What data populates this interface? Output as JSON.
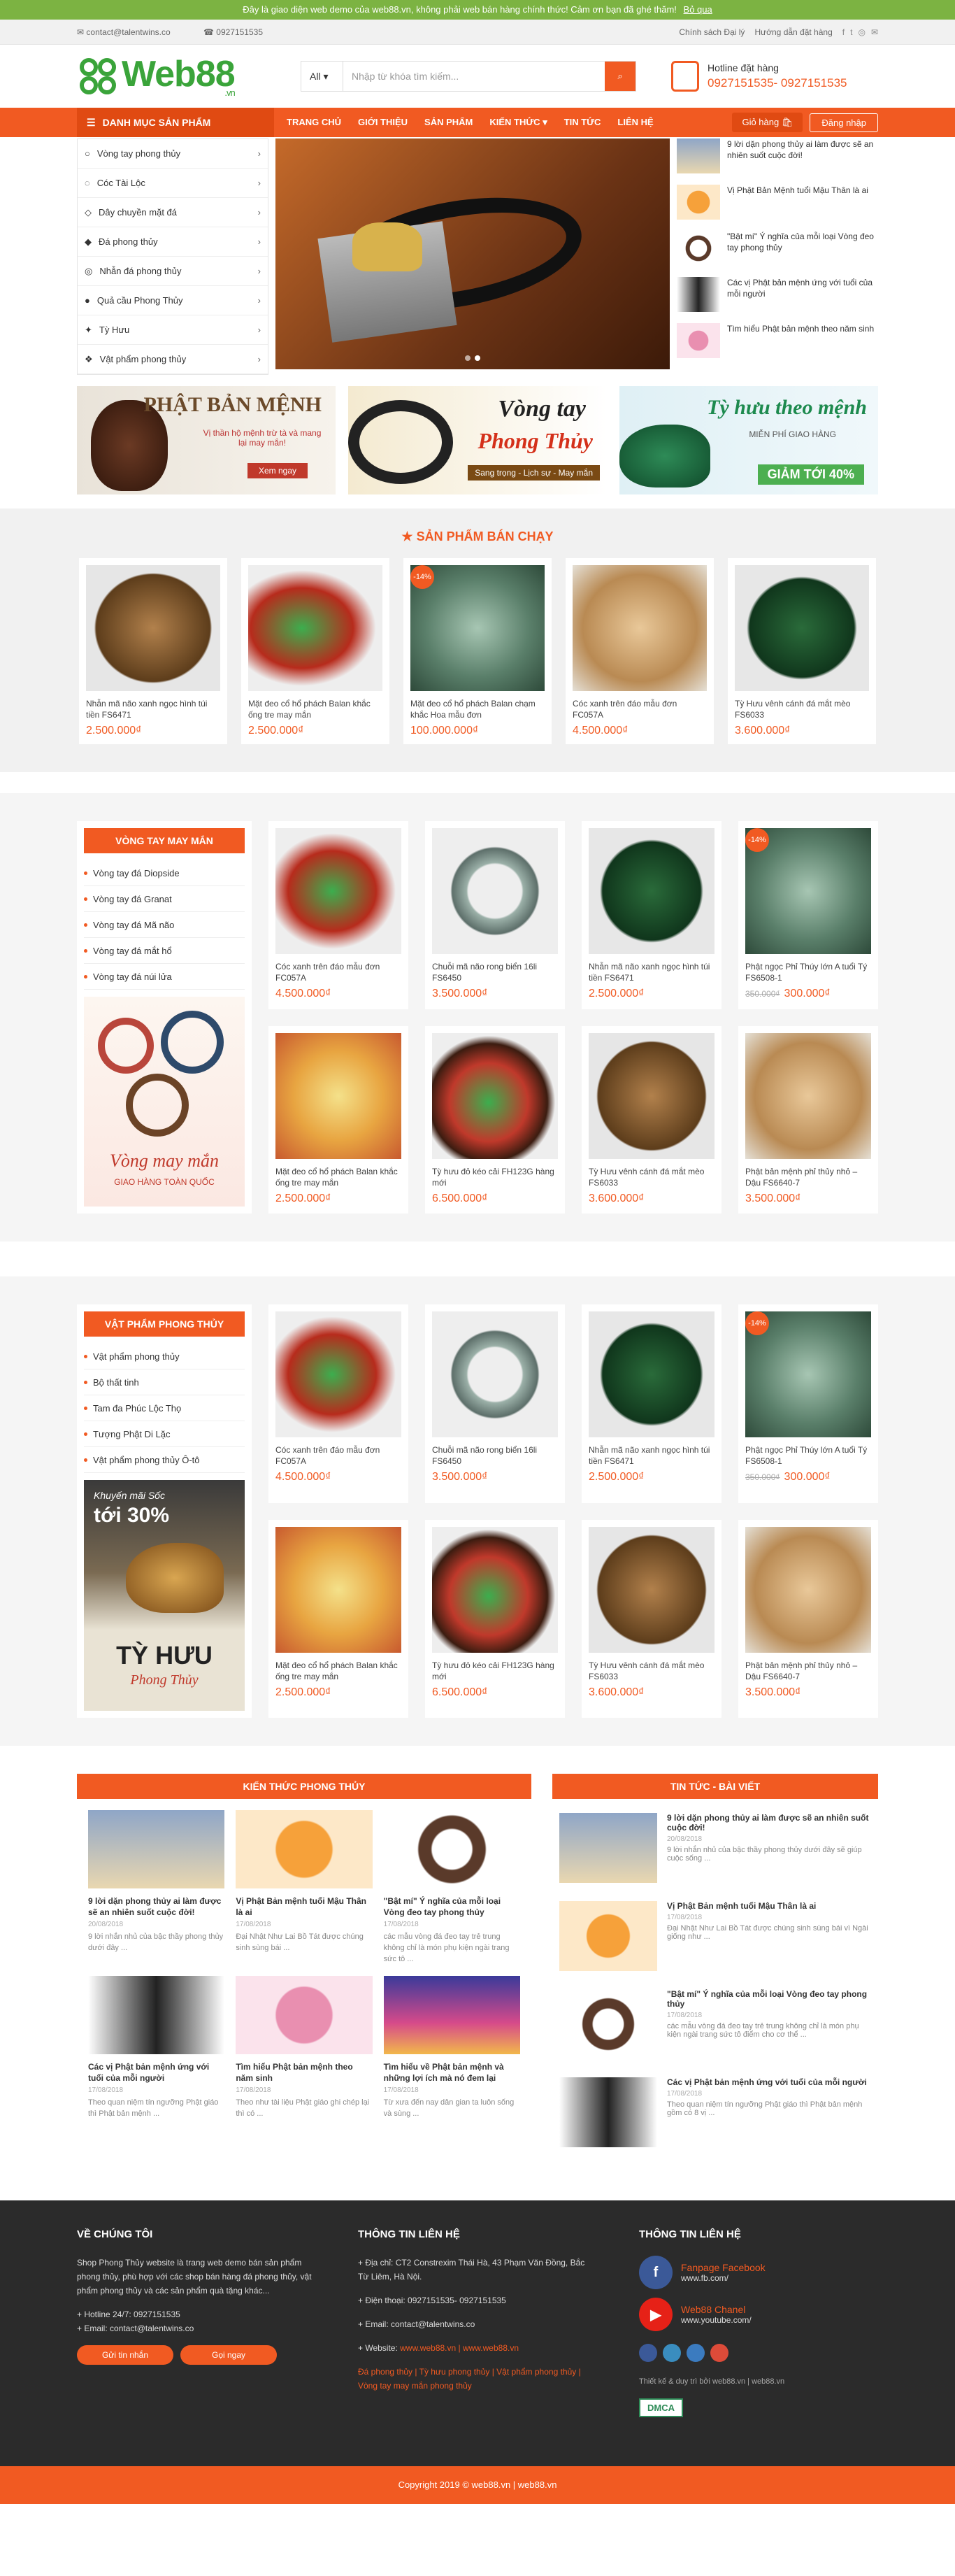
{
  "notice": {
    "text": "Đây là giao diện web demo của web88.vn, không phải web bán hàng chính thức! Cảm ơn bạn đã ghé thăm!",
    "dismiss": "Bỏ qua"
  },
  "topbar": {
    "email": "contact@talentwins.co",
    "phone": "0927151535",
    "policy": "Chính sách Đại lý",
    "guide": "Hướng dẫn đặt hàng"
  },
  "logo": {
    "text": "Web88",
    "sub": ".vn"
  },
  "search": {
    "category": "All",
    "placeholder": "Nhập từ khóa tìm kiếm..."
  },
  "hotline": {
    "label": "Hotline đặt hàng",
    "numbers": "0927151535- 0927151535"
  },
  "nav": {
    "category_label": "DANH MỤC SẢN PHẨM",
    "items": [
      "TRANG CHỦ",
      "GIỚI THIỆU",
      "SẢN PHẨM",
      "KIẾN THỨC",
      "TIN TỨC",
      "LIÊN HỆ"
    ],
    "cart": "Giỏ hàng",
    "login": "Đăng nhập"
  },
  "categories": [
    "Vòng tay phong thủy",
    "Cóc Tài Lộc",
    "Dây chuyền mặt đá",
    "Đá phong thủy",
    "Nhẫn đá phong thủy",
    "Quả cầu Phong Thủy",
    "Tỳ Hưu",
    "Vật phẩm phong thủy"
  ],
  "side_news": [
    "9 lời dặn phong thủy ai làm được sẽ an nhiên suốt cuộc đời!",
    "Vị Phật Bản Mệnh tuổi Mậu Thân là ai",
    "\"Bật mí\" Ý nghĩa của mỗi loại Vòng đeo tay phong thủy",
    "Các vị Phật bản mệnh ứng với tuổi của mỗi người",
    "Tìm hiểu Phật bản mệnh theo năm sinh"
  ],
  "banners": [
    {
      "title": "PHẬT BẢN MỆNH",
      "sub": "Vị thần hộ mệnh trừ tà và mang lại may mắn!",
      "btn": "Xem ngay"
    },
    {
      "title": "Vòng tay",
      "title2": "Phong Thủy",
      "sub": "Sang trọng - Lịch sự - May mắn"
    },
    {
      "title": "Tỳ hưu theo mệnh",
      "sub": "MIỄN PHÍ GIAO HÀNG",
      "promo": "GIẢM TỚI 40%"
    }
  ],
  "bestsellers": {
    "title": "SẢN PHẨM BÁN CHẠY",
    "items": [
      {
        "name": "Nhẫn mã não xanh ngọc hình túi tiền FS6471",
        "price": "2.500.000₫",
        "badge": ""
      },
      {
        "name": "Mặt đeo cổ hổ phách Balan khắc ống tre may mắn",
        "price": "2.500.000₫",
        "badge": ""
      },
      {
        "name": "Mặt đeo cổ hổ phách Balan chạm khắc Hoa mẫu đơn",
        "price": "100.000.000₫",
        "badge": "-14%"
      },
      {
        "name": "Cóc xanh trên đáo mẫu đơn FC057A",
        "price": "4.500.000₫",
        "badge": ""
      },
      {
        "name": "Tỳ Hưu vênh cánh đá mắt mèo FS6033",
        "price": "3.600.000₫",
        "badge": ""
      }
    ]
  },
  "block1": {
    "title": "VÒNG TAY MAY MẮN",
    "links": [
      "Vòng tay đá Diopside",
      "Vòng tay đá Granat",
      "Vòng tay đá Mã não",
      "Vòng tay đá mắt hổ",
      "Vòng tay đá núi lửa"
    ],
    "promo": "Vòng may mắn",
    "promo_sub": "GIAO HÀNG TOÀN QUỐC"
  },
  "block2": {
    "title": "VẬT PHẨM PHONG THỦY",
    "links": [
      "Vật phẩm phong thủy",
      "Bộ thất tinh",
      "Tam đa Phúc Lộc Thọ",
      "Tượng Phật Di Lặc",
      "Vật phẩm phong thủy Ô-tô"
    ],
    "promo_top": "Khuyến mãi Sốc",
    "promo_pct": "tới 30%",
    "promo_name": "TỲ HƯU",
    "promo_sub": "Phong Thủy"
  },
  "products": [
    {
      "name": "Cóc xanh trên đáo mẫu đơn FC057A",
      "price": "4.500.000₫",
      "old": "",
      "badge": ""
    },
    {
      "name": "Chuỗi mã não rong biển 16li FS6450",
      "price": "3.500.000₫",
      "old": "",
      "badge": ""
    },
    {
      "name": "Nhẫn mã não xanh ngọc hình túi tiền FS6471",
      "price": "2.500.000₫",
      "old": "",
      "badge": ""
    },
    {
      "name": "Phật ngọc Phỉ Thúy lớn A tuổi Tý FS6508-1",
      "price": "300.000₫",
      "old": "350.000₫",
      "badge": "-14%"
    },
    {
      "name": "Mặt đeo cổ hổ phách Balan khắc ống tre may mắn",
      "price": "2.500.000₫",
      "old": "",
      "badge": ""
    },
    {
      "name": "Tỳ hưu đỏ kéo cải FH123G hàng mới",
      "price": "6.500.000₫",
      "old": "",
      "badge": ""
    },
    {
      "name": "Tỳ Hưu vênh cánh đá mắt mèo FS6033",
      "price": "3.600.000₫",
      "old": "",
      "badge": ""
    },
    {
      "name": "Phật bản mệnh phỉ thủy nhỏ – Dậu FS6640-7",
      "price": "3.500.000₫",
      "old": "",
      "badge": ""
    }
  ],
  "knowledge": {
    "title": "KIẾN THỨC PHONG THỦY",
    "items": [
      {
        "t": "9 lời dặn phong thủy ai làm được sẽ an nhiên suốt cuộc đời!",
        "d": "20/08/2018",
        "x": "9 lời nhắn nhủ của bậc thầy phong thủy dưới đây ..."
      },
      {
        "t": "Vị Phật Bản mệnh tuổi Mậu Thân là ai",
        "d": "17/08/2018",
        "x": "Đại Nhật Như Lai Bồ Tát được chúng sinh sùng bái ..."
      },
      {
        "t": "\"Bật mí\" Ý nghĩa của mỗi loại Vòng đeo tay phong thủy",
        "d": "17/08/2018",
        "x": "các mẫu vòng đá đeo tay trẻ trung không chỉ là món phụ kiện ngài trang sức tô ..."
      },
      {
        "t": "Các vị Phật bản mệnh ứng với tuổi của mỗi người",
        "d": "17/08/2018",
        "x": "Theo quan niệm tín ngưỡng Phật giáo thì Phật bản mệnh ..."
      },
      {
        "t": "Tìm hiểu Phật bản mệnh theo năm sinh",
        "d": "17/08/2018",
        "x": "Theo như tài liệu Phật giáo ghi chép lại thì có ..."
      },
      {
        "t": "Tìm hiểu về Phật bản mệnh và những lợi ích mà nó đem lại",
        "d": "17/08/2018",
        "x": "Từ xưa đến nay dân gian ta luôn sống và sùng ..."
      }
    ]
  },
  "newsblock": {
    "title": "TIN TỨC - BÀI VIẾT",
    "items": [
      {
        "t": "9 lời dặn phong thủy ai làm được sẽ an nhiên suốt cuộc đời!",
        "d": "20/08/2018",
        "x": "9 lời nhắn nhủ của bậc thầy phong thủy dưới đây sẽ giúp cuộc sống ..."
      },
      {
        "t": "Vị Phật Bản mệnh tuổi Mậu Thân là ai",
        "d": "17/08/2018",
        "x": "Đại Nhật Như Lai Bồ Tát được chúng sinh sùng bái vì Ngài giống như ..."
      },
      {
        "t": "\"Bật mí\" Ý nghĩa của mỗi loại Vòng đeo tay phong thủy",
        "d": "17/08/2018",
        "x": "các mẫu vòng đá đeo tay trẻ trung không chỉ là món phụ kiện ngài trang sức tô điểm cho cơ thể ..."
      },
      {
        "t": "Các vị Phật bản mệnh ứng với tuổi của mỗi người",
        "d": "17/08/2018",
        "x": "Theo quan niệm tín ngưỡng Phật giáo thì Phật bản mệnh gồm có 8 vị ..."
      }
    ]
  },
  "footer": {
    "about_title": "VỀ CHÚNG TÔI",
    "about_text": "Shop Phong Thủy website là trang web demo bán sản phẩm phong thủy, phù hợp với các shop bán hàng đá phong thủy, vật phẩm phong thủy và các sản phẩm quà tặng khác...",
    "hotline": "+ Hotline 24/7: 0927151535",
    "email": "+ Email: contact@talentwins.co",
    "btn1": "Gửi tin nhắn",
    "btn2": "Gọi ngay",
    "contact_title": "THÔNG TIN LIÊN HỆ",
    "address": "+ Địa chỉ: CT2 Constrexim Thái Hà, 43 Phạm Văn Đồng, Bắc Từ Liêm, Hà Nội.",
    "phone": "+ Điện thoại: 0927151535- 0927151535",
    "mail": "+ Email: contact@talentwins.co",
    "website_label": "+ Website: ",
    "website": "www.web88.vn | www.web88.vn",
    "tags": "Đá phong thủy | Tỳ hưu phong thủy | Vật phẩm phong thủy | Vòng tay may mắn phong thủy",
    "info_title": "THÔNG TIN LIÊN HỆ",
    "fb_name": "Fanpage Facebook",
    "fb_url": "www.fb.com/",
    "yt_name": "Web88 Chanel",
    "yt_url": "www.youtube.com/",
    "credit": "Thiết kế & duy trì bởi web88.vn | web88.vn",
    "dmca": "DMCA",
    "copyright": "Copyright 2019 © web88.vn | web88.vn"
  }
}
